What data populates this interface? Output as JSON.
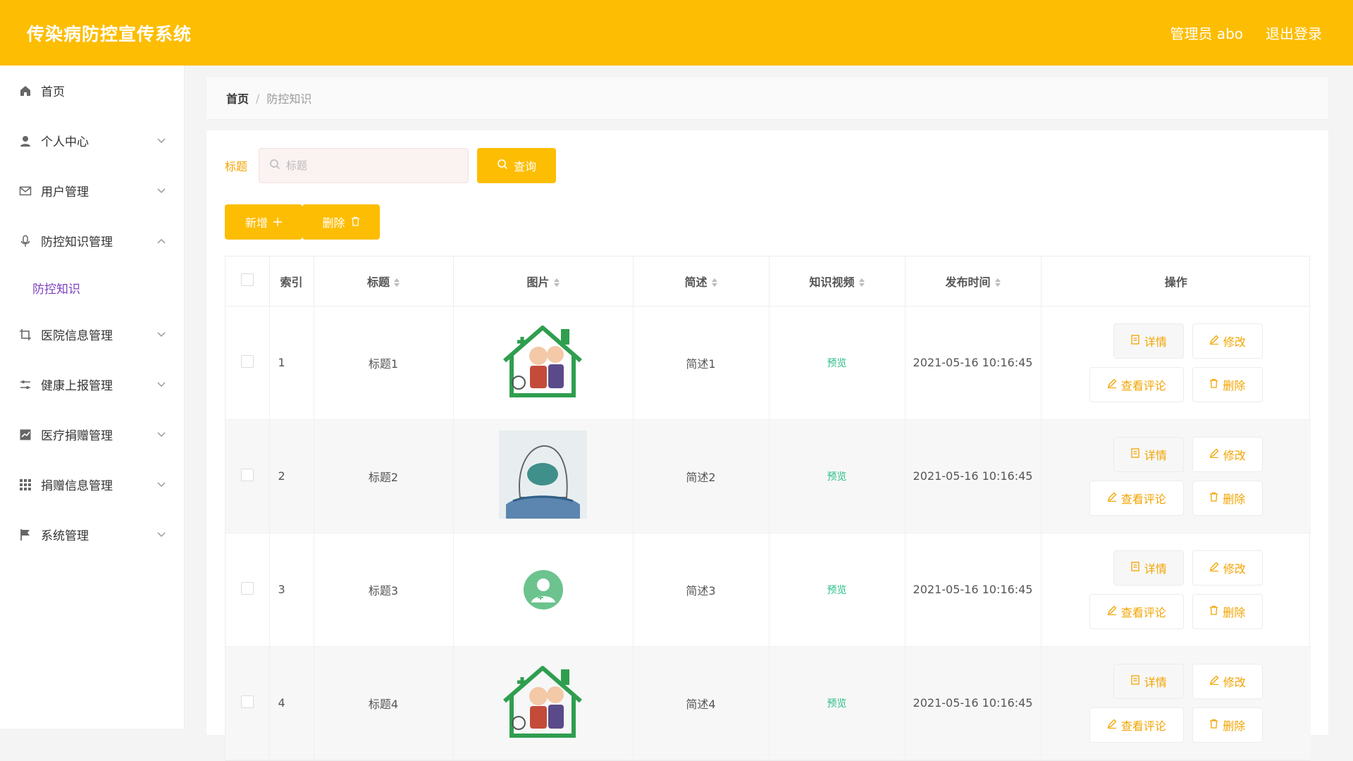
{
  "header": {
    "title": "传染病防控宣传系统",
    "admin": "管理员 abo",
    "logout": "退出登录"
  },
  "sidebar": {
    "items": [
      {
        "label": "首页",
        "icon": "home-icon"
      },
      {
        "label": "个人中心",
        "icon": "user-icon"
      },
      {
        "label": "用户管理",
        "icon": "mail-icon"
      },
      {
        "label": "防控知识管理",
        "icon": "mic-icon",
        "expanded": true,
        "children": [
          {
            "label": "防控知识"
          }
        ]
      },
      {
        "label": "医院信息管理",
        "icon": "crop-icon"
      },
      {
        "label": "健康上报管理",
        "icon": "sliders-icon"
      },
      {
        "label": "医疗捐赠管理",
        "icon": "chart-icon"
      },
      {
        "label": "捐赠信息管理",
        "icon": "grid-icon"
      },
      {
        "label": "系统管理",
        "icon": "flag-icon"
      }
    ]
  },
  "breadcrumb": {
    "home": "首页",
    "sep": "/",
    "current": "防控知识"
  },
  "search": {
    "label": "标题",
    "placeholder": "标题",
    "query": "查询"
  },
  "actions": {
    "add": "新增",
    "delete": "删除"
  },
  "table": {
    "columns": [
      "索引",
      "标题",
      "图片",
      "简述",
      "知识视频",
      "发布时间",
      "操作"
    ],
    "rows": [
      {
        "index": "1",
        "title": "标题1",
        "image": "house-elderly-image",
        "desc": "简述1",
        "video": "预览",
        "time": "2021-05-16 10:16:45"
      },
      {
        "index": "2",
        "title": "标题2",
        "image": "masked-person-sketch-image",
        "desc": "简述2",
        "video": "预览",
        "time": "2021-05-16 10:16:45"
      },
      {
        "index": "3",
        "title": "标题3",
        "image": "doctor-avatar-image",
        "desc": "简述3",
        "video": "预览",
        "time": "2021-05-16 10:16:45"
      },
      {
        "index": "4",
        "title": "标题4",
        "image": "house-elderly-image",
        "desc": "简述4",
        "video": "预览",
        "time": "2021-05-16 10:16:45"
      }
    ],
    "ops": {
      "detail": "详情",
      "edit": "修改",
      "comment": "查看评论",
      "delete": "删除"
    }
  },
  "colors": {
    "accent": "#fdbd02",
    "submenu_active": "#7b3fbf",
    "preview": "#2bbf86"
  }
}
